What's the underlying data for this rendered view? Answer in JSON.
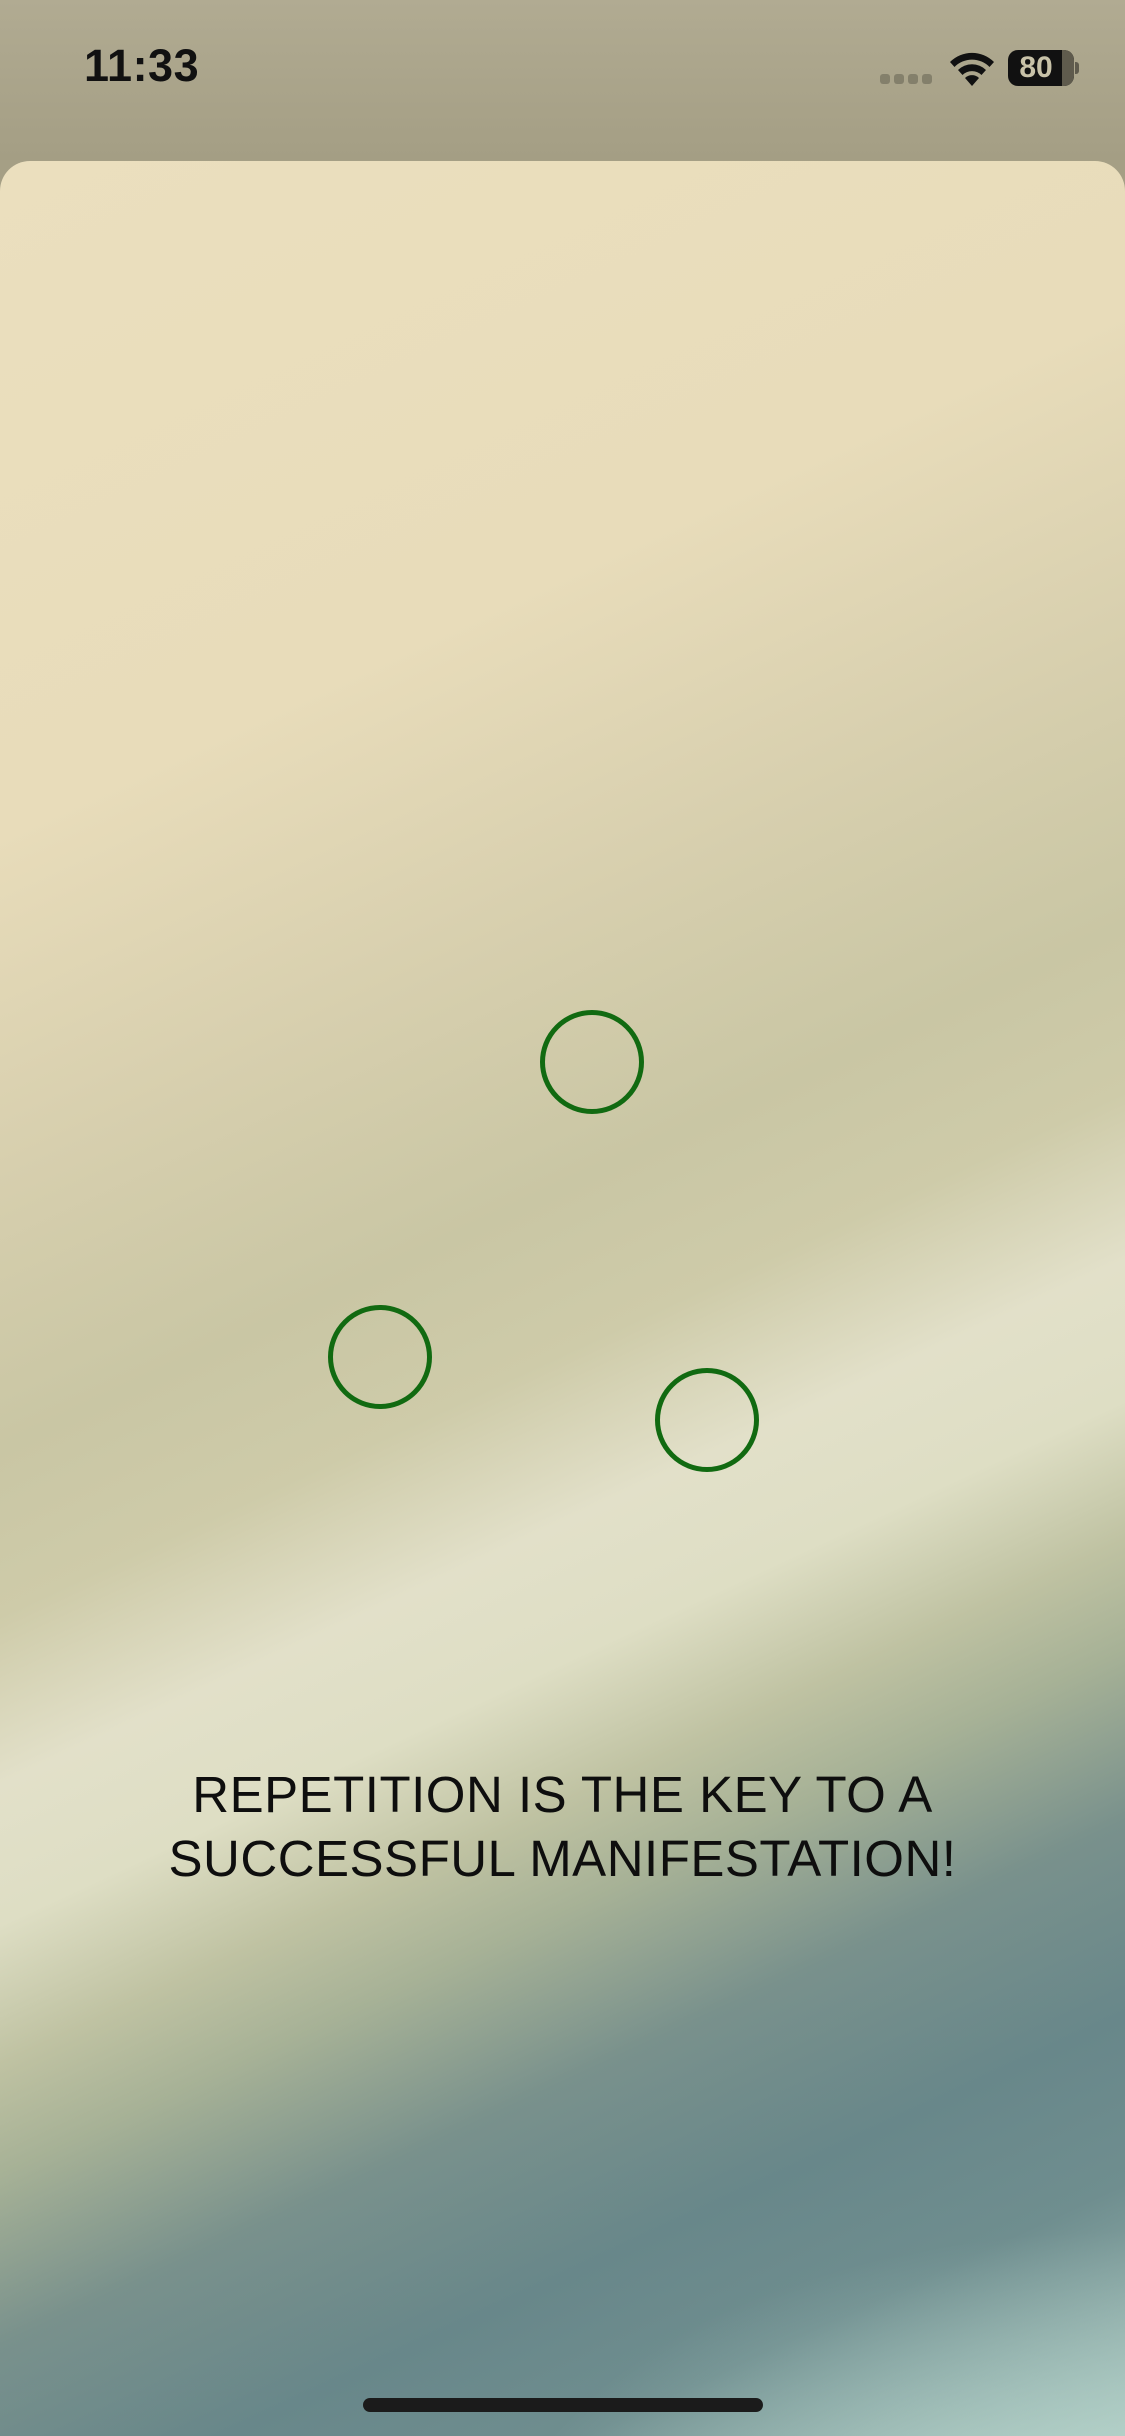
{
  "status_bar": {
    "time": "11:33",
    "battery_level": "80",
    "icons": [
      "signal-icon",
      "wifi-icon",
      "battery-icon"
    ]
  },
  "main": {
    "circles": [
      {
        "name": "target-circle-1"
      },
      {
        "name": "target-circle-2"
      },
      {
        "name": "target-circle-3"
      }
    ],
    "message": "REPETITION IS THE KEY TO A SUCCESSFUL MANIFESTATION!"
  },
  "colors": {
    "circle_stroke": "#116a11",
    "text": "#0e0e0e"
  }
}
